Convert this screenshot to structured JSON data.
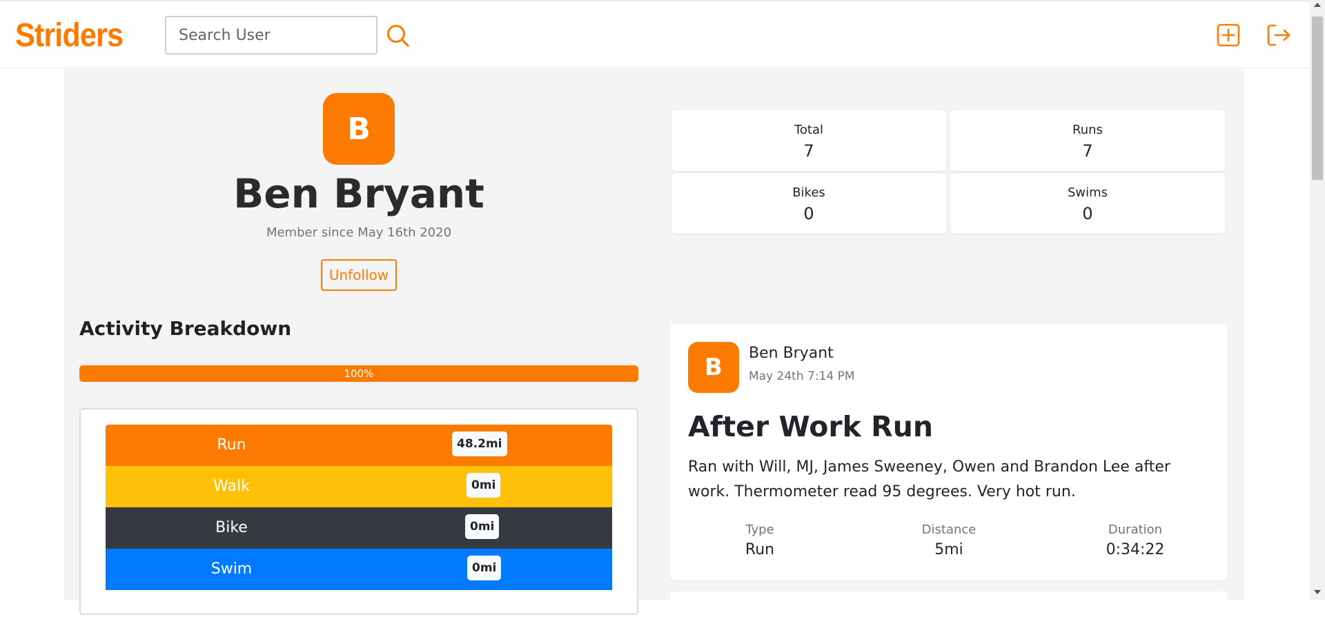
{
  "header": {
    "brand": "Striders",
    "search_placeholder": "Search User",
    "accent_color": "#fd7a00",
    "icons": [
      "search-icon",
      "add-activity-icon",
      "logout-icon"
    ]
  },
  "profile": {
    "avatar_initial": "B",
    "name": "Ben Bryant",
    "member_since": "Member since May 16th 2020",
    "follow_button": "Unfollow"
  },
  "stats": [
    {
      "label": "Total",
      "value": "7"
    },
    {
      "label": "Runs",
      "value": "7"
    },
    {
      "label": "Bikes",
      "value": "0"
    },
    {
      "label": "Swims",
      "value": "0"
    }
  ],
  "breakdown": {
    "title": "Activity Breakdown",
    "progress_label": "100%",
    "progress_fraction": 1.0,
    "activities": [
      {
        "label": "Run",
        "distance": "48.2mi",
        "color": "#fd7a00"
      },
      {
        "label": "Walk",
        "distance": "0mi",
        "color": "#ffc107"
      },
      {
        "label": "Bike",
        "distance": "0mi",
        "color": "#343a40"
      },
      {
        "label": "Swim",
        "distance": "0mi",
        "color": "#007bff"
      }
    ]
  },
  "post": {
    "avatar_initial": "B",
    "author": "Ben Bryant",
    "date": "May 24th 7:14 PM",
    "title": "After Work Run",
    "description": "Ran with Will, MJ, James Sweeney, Owen and Brandon Lee after work. Thermometer read 95 degrees. Very hot run.",
    "stats": [
      {
        "label": "Type",
        "value": "Run"
      },
      {
        "label": "Distance",
        "value": "5mi"
      },
      {
        "label": "Duration",
        "value": "0:34:22"
      }
    ]
  }
}
